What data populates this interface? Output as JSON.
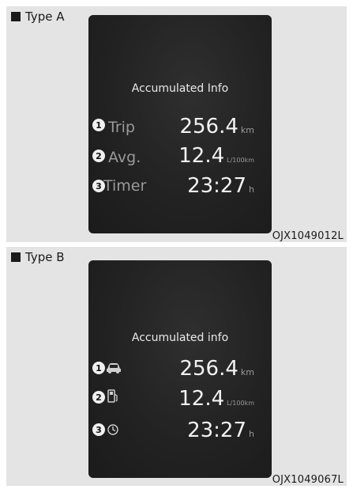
{
  "type_a": {
    "label": "Type A",
    "code": "OJX1049012L",
    "screen_title": "Accumulated Info",
    "rows": [
      {
        "num": "1",
        "label": "Trip",
        "value": "256.4",
        "unit": "km"
      },
      {
        "num": "2",
        "label": "Avg.",
        "value": "12.4",
        "unit": "L/100km"
      },
      {
        "num": "3",
        "label": "Timer",
        "value": "23:27",
        "unit": "h"
      }
    ]
  },
  "type_b": {
    "label": "Type B",
    "code": "OJX1049067L",
    "screen_title": "Accumulated info",
    "rows": [
      {
        "num": "1",
        "icon": "car-icon",
        "value": "256.4",
        "unit": "km"
      },
      {
        "num": "2",
        "icon": "fuel-pump-icon",
        "value": "12.4",
        "unit": "L/100km"
      },
      {
        "num": "3",
        "icon": "clock-icon",
        "value": "23:27",
        "unit": "h"
      }
    ]
  }
}
